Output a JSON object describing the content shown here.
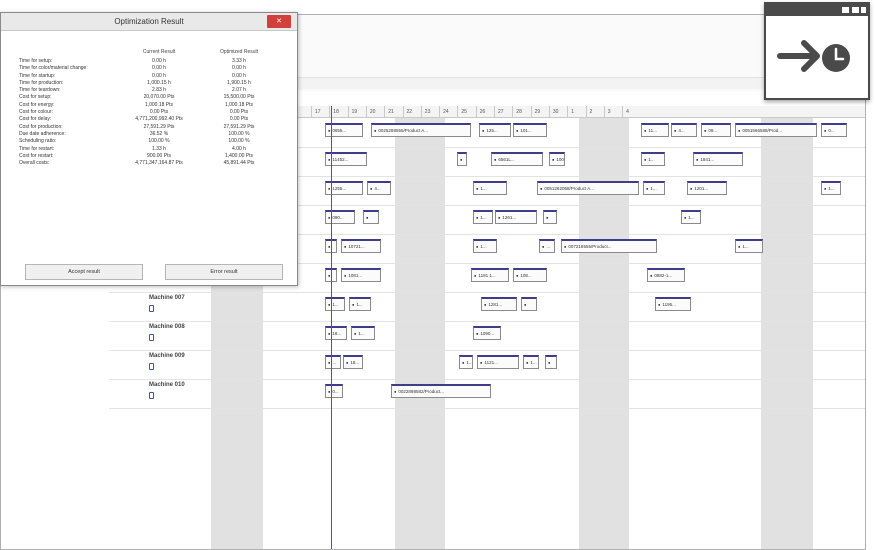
{
  "dialog": {
    "title": "Optimization Result",
    "close_glyph": "✕",
    "col_current": "Current Result",
    "col_optimized": "Optimized Result",
    "rows": [
      {
        "label": "Time for setup:",
        "current": "0.00 h",
        "optimized": "3.33 h"
      },
      {
        "label": "Time for color/material change:",
        "current": "0.00 h",
        "optimized": "0.00 h"
      },
      {
        "label": "Time for startup:",
        "current": "0.00 h",
        "optimized": "0.00 h"
      },
      {
        "label": "Time for production:",
        "current": "1,000.15 h",
        "optimized": "1,900.15 h"
      },
      {
        "label": "Time for teardown:",
        "current": "2.83 h",
        "optimized": "2.07 h"
      },
      {
        "label": "Cost for setup:",
        "current": "20,070.00 Pts",
        "optimized": "15,500.00 Pts"
      },
      {
        "label": "Cost for energy:",
        "current": "1,000.18 Pts",
        "optimized": "1,000.18 Pts"
      },
      {
        "label": "Cost for colour:",
        "current": "0.00 Pts",
        "optimized": "0.00 Pts"
      },
      {
        "label": "Cost for delay:",
        "current": "4,771,200,992.40 Pts",
        "optimized": "0.00 Pts"
      },
      {
        "label": "Cost for production:",
        "current": "27,591.29 Pts",
        "optimized": "27,591.29 Pts"
      },
      {
        "label": "Due date adherence:",
        "current": "36.52 %",
        "optimized": "100.00 %"
      },
      {
        "label": "Scheduling ratio:",
        "current": "100.00 %",
        "optimized": "100.00 %"
      },
      {
        "label": "Time for restart:",
        "current": "1.33 h",
        "optimized": "4.00 h"
      },
      {
        "label": "Cost for restart:",
        "current": "900.00 Pts",
        "optimized": "1,400.00 Pts"
      },
      {
        "label": "Overall costs:",
        "current": "4,771,347,164.87 Pts",
        "optimized": "45,891.44 Pts"
      }
    ],
    "accept_label": "Accept result",
    "error_label": "Error result"
  },
  "timeline": {
    "days": [
      "17",
      "18",
      "19",
      "20",
      "21",
      "22",
      "23",
      "24",
      "25",
      "26",
      "27",
      "28",
      "29",
      "30",
      "1",
      "2",
      "3",
      "4"
    ]
  },
  "machines": [
    {
      "label": "",
      "jobs": [
        "0655...",
        "0025288555/Product A...",
        "125...",
        "101...",
        "11...",
        "4...",
        "09...",
        "0051566588/Prod...",
        "0..."
      ]
    },
    {
      "label": "",
      "jobs": [
        "11452...",
        "",
        "6561L...",
        "100...",
        "1...",
        "1841..."
      ]
    },
    {
      "label": "",
      "jobs": [
        "1255...",
        "4...",
        "1...",
        "0051262058/Product A...",
        "1...",
        "1201...",
        "1..."
      ]
    },
    {
      "label": "",
      "jobs": [
        "090...",
        "",
        "1...",
        "1261...",
        "",
        "1..."
      ]
    },
    {
      "label": "",
      "jobs": [
        "",
        "10721...",
        "1...",
        "...",
        "007218555/Product...",
        "1..."
      ]
    },
    {
      "label": "",
      "jobs": [
        "",
        "1081...",
        "1181 1...",
        "108...",
        "0882-1..."
      ]
    },
    {
      "label": "Machine 007",
      "jobs": [
        "1...",
        "1...",
        "1281...",
        "",
        "1195..."
      ]
    },
    {
      "label": "Machine 008",
      "jobs": [
        "18...",
        "1...",
        "1090..."
      ]
    },
    {
      "label": "Machine 009",
      "jobs": [
        "...",
        "18...",
        "1...",
        "1121...",
        "1...",
        ""
      ]
    },
    {
      "label": "Machine 010",
      "jobs": [
        "0...",
        "0022898582/Product..."
      ]
    }
  ],
  "colors": {
    "accent": "#3d3d8a",
    "close": "#d2403b",
    "now_line": "#c03030"
  },
  "badge": {
    "icon": "export-to-clock-icon"
  }
}
